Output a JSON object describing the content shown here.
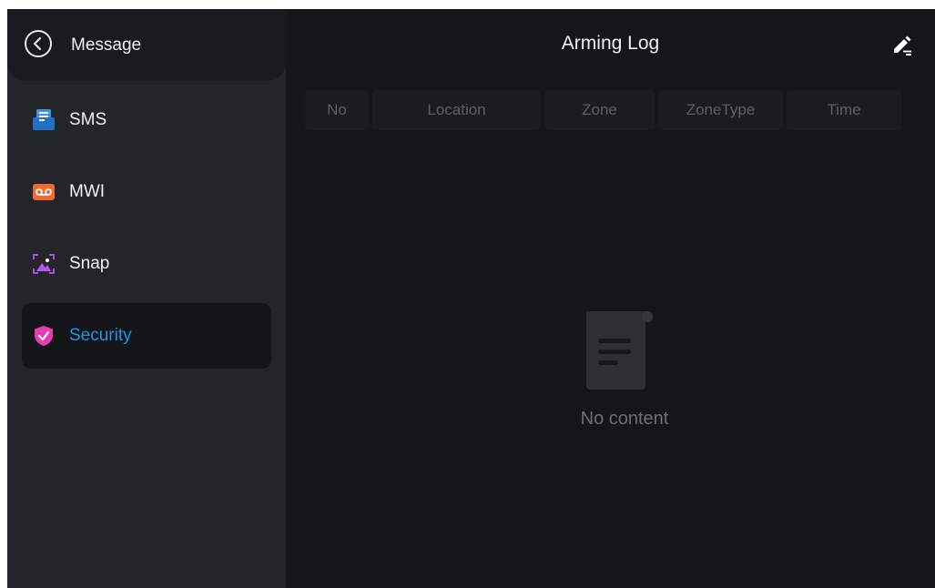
{
  "sidebar": {
    "back_icon": "chevron-left-icon",
    "title": "Message",
    "items": [
      {
        "label": "SMS",
        "icon": "sms-icon",
        "color": "#2d8ce6"
      },
      {
        "label": "MWI",
        "icon": "voicemail-icon",
        "color": "#f06a2d"
      },
      {
        "label": "Snap",
        "icon": "snap-image-icon",
        "color": "#a64ae8"
      },
      {
        "label": "Security",
        "icon": "shield-check-icon",
        "color": "#e83ab4"
      }
    ],
    "active_item": "Security",
    "active_color": "#1e96e8"
  },
  "main": {
    "title": "Arming Log",
    "edit_icon": "edit-icon",
    "columns": [
      "No",
      "Location",
      "Zone",
      "ZoneType",
      "Time"
    ],
    "empty_icon": "document-icon",
    "empty_text": "No content"
  }
}
